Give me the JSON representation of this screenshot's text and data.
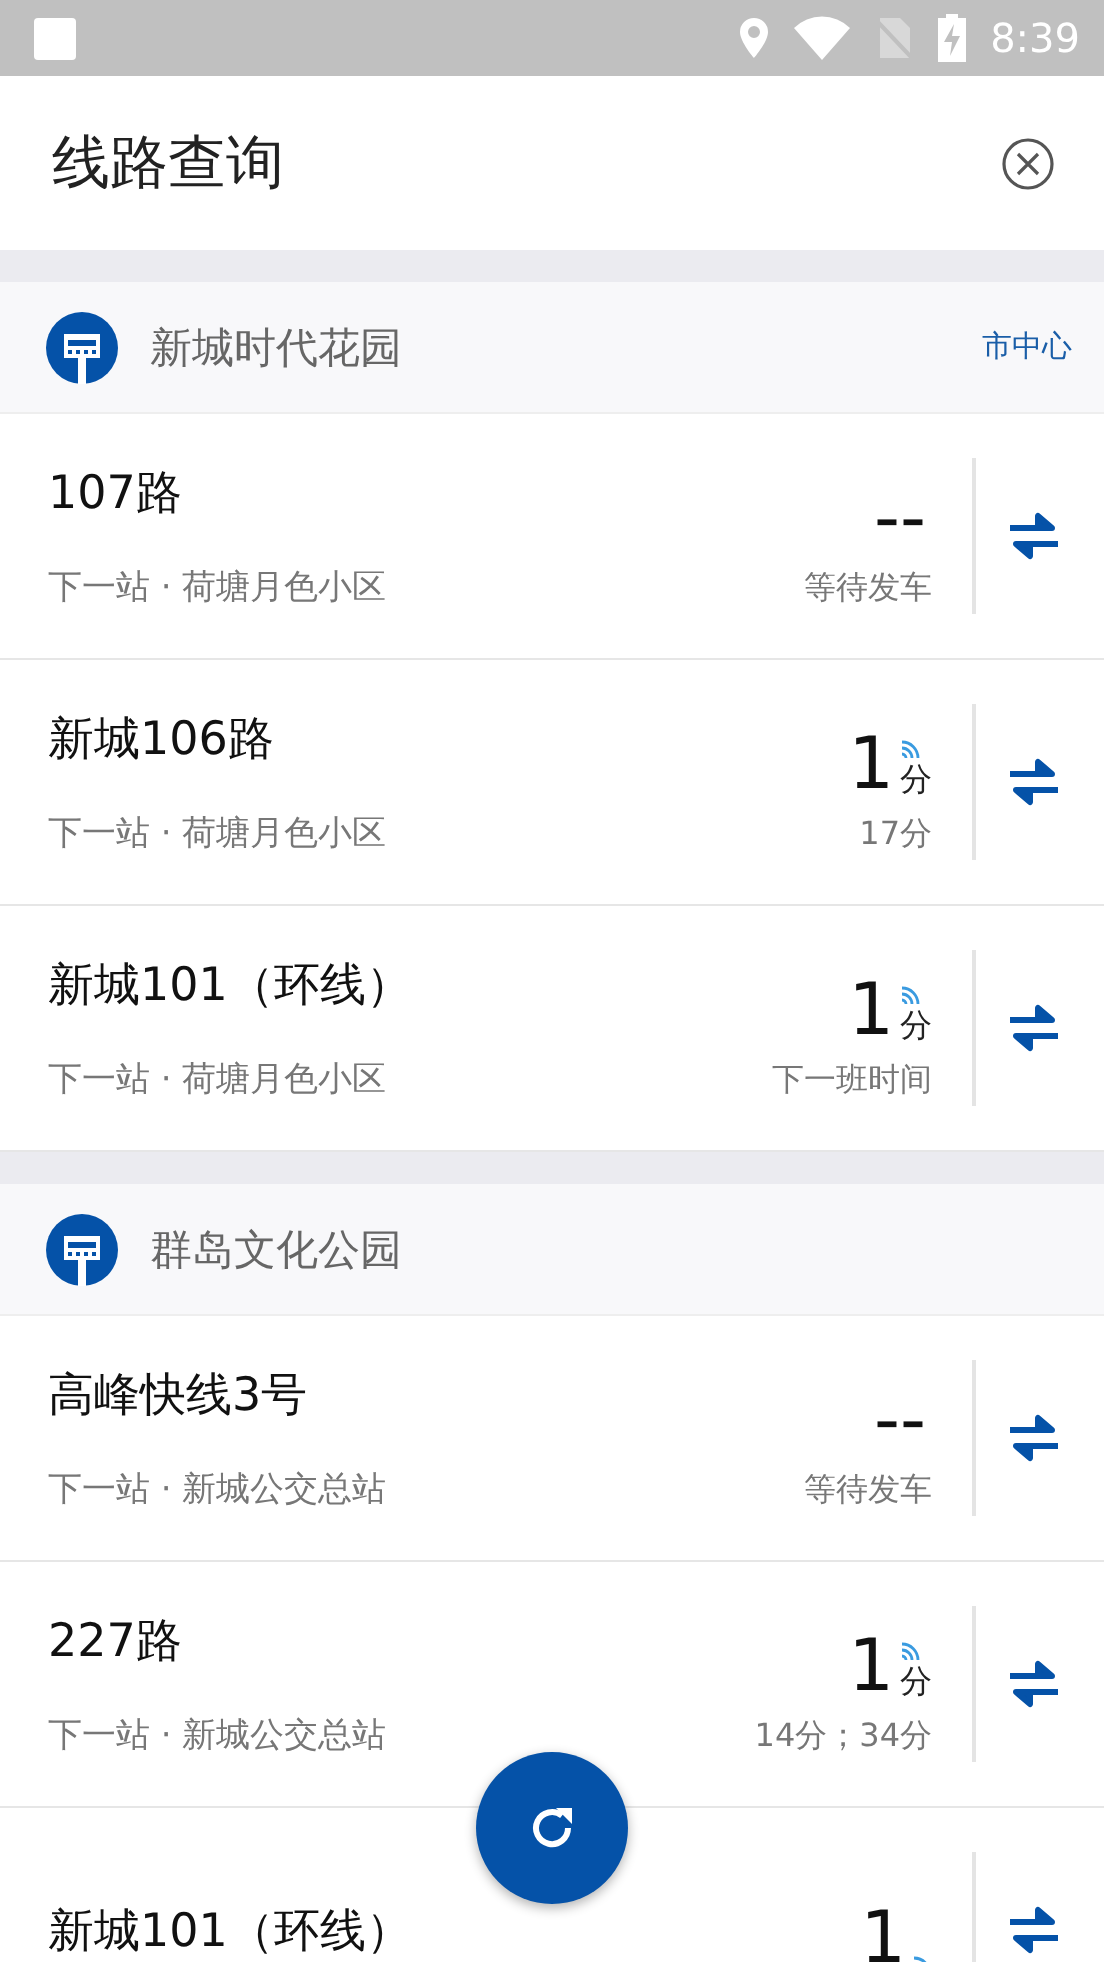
{
  "status_bar": {
    "time": "8:39"
  },
  "header": {
    "title": "线路查询"
  },
  "stops": [
    {
      "name": "新城时代花园",
      "direction": "市中心",
      "routes": [
        {
          "name": "107路",
          "next_stop": "下一站 · 荷塘月色小区",
          "arrival": "--",
          "realtime": false,
          "note": "等待发车"
        },
        {
          "name": "新城106路",
          "next_stop": "下一站 · 荷塘月色小区",
          "arrival": "1",
          "unit": "分",
          "realtime": true,
          "note": "17分"
        },
        {
          "name": "新城101（环线）",
          "next_stop": "下一站 · 荷塘月色小区",
          "arrival": "1",
          "unit": "分",
          "realtime": true,
          "note": "下一班时间"
        }
      ]
    },
    {
      "name": "群岛文化公园",
      "routes": [
        {
          "name": "高峰快线3号",
          "next_stop": "下一站 · 新城公交总站",
          "arrival": "--",
          "realtime": false,
          "note": "等待发车"
        },
        {
          "name": "227路",
          "next_stop": "下一站 · 新城公交总站",
          "arrival": "1",
          "unit": "分",
          "realtime": true,
          "note": "14分；34分"
        },
        {
          "name": "新城101（环线）",
          "arrival": "1",
          "realtime": true
        }
      ]
    }
  ]
}
